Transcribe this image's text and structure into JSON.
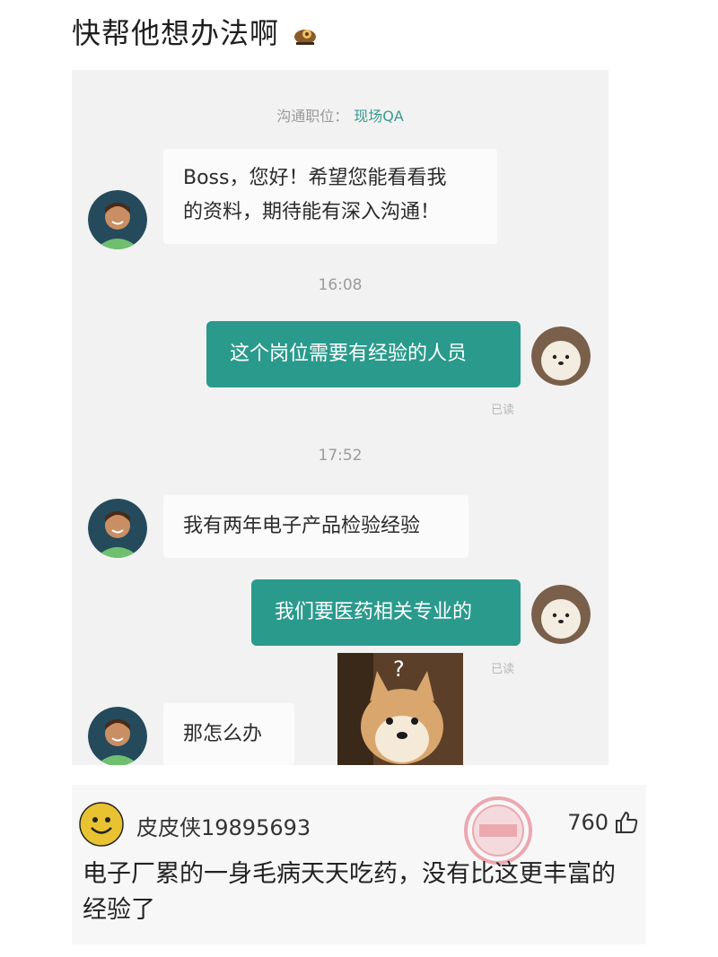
{
  "post": {
    "title": "快帮他想办法啊"
  },
  "chat": {
    "job_label": "沟通职位：",
    "job_value": "现场QA",
    "messages": [
      {
        "side": "in",
        "text_line1": "Boss，您好！希望您能看看我",
        "text_line2": "的资料，期待能有深入沟通！"
      },
      {
        "side": "time",
        "text": "16:08"
      },
      {
        "side": "out",
        "text": "这个岗位需要有经验的人员",
        "status": "已读"
      },
      {
        "side": "time",
        "text": "17:52"
      },
      {
        "side": "in",
        "text": "我有两年电子产品检验经验"
      },
      {
        "side": "out",
        "text": "我们要医药相关专业的",
        "status": "已读"
      },
      {
        "side": "in",
        "text": "那怎么办"
      }
    ],
    "sticker": {
      "icon": "confused-shiba-doge-sticker",
      "mark": "?"
    }
  },
  "comment": {
    "username": "皮皮侠19895693",
    "likes": "760",
    "text": "电子厂累的一身毛病天天吃药，没有比这更丰富的经验了",
    "stamp_icon": "shenping-stamp",
    "avatar_icon": "smiley-avatar"
  },
  "colors": {
    "accent": "#2a9a8c",
    "chat_bg": "#f2f2f2",
    "bubble_in": "#fbfbfb"
  }
}
